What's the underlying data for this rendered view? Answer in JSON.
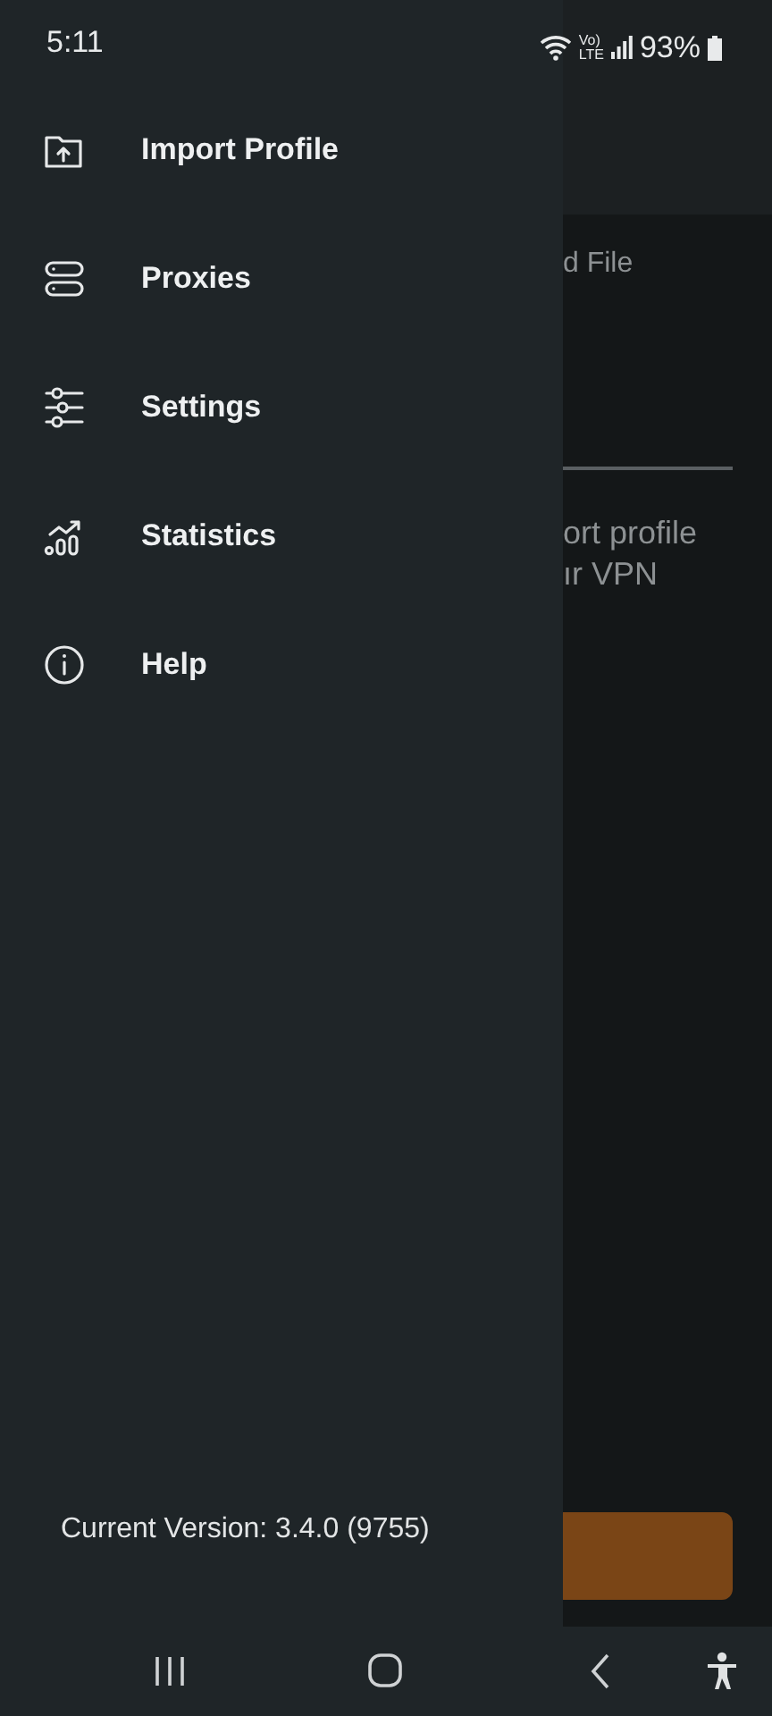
{
  "status_bar": {
    "time": "5:11",
    "network_badge": {
      "top": "Vo)",
      "bottom": "LTE"
    },
    "battery": "93%"
  },
  "background": {
    "texts": [
      "d File"
    ],
    "description_lines": [
      "ort profile",
      "ır VPN"
    ]
  },
  "drawer": {
    "items": [
      {
        "kind": "import",
        "label": "Import Profile"
      },
      {
        "kind": "proxies",
        "label": "Proxies"
      },
      {
        "kind": "settings",
        "label": "Settings"
      },
      {
        "kind": "statistics",
        "label": "Statistics"
      },
      {
        "kind": "help",
        "label": "Help"
      }
    ],
    "version": "Current Version: 3.4.0 (9755)"
  }
}
